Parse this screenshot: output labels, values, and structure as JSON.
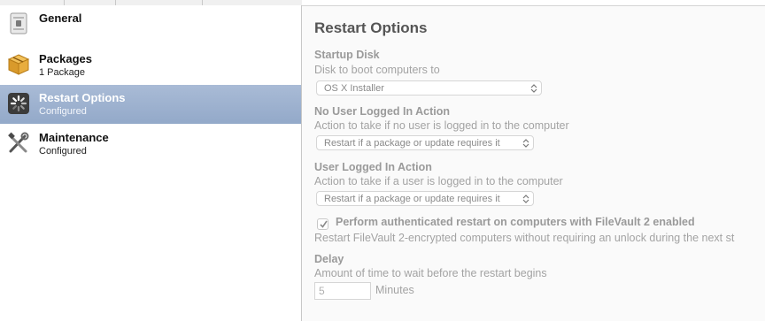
{
  "sidebar": {
    "items": [
      {
        "title": "General",
        "subtitle": "",
        "icon": "general-doc-icon"
      },
      {
        "title": "Packages",
        "subtitle": "1 Package",
        "icon": "package-box-icon"
      },
      {
        "title": "Restart Options",
        "subtitle": "Configured",
        "icon": "restart-spinner-icon",
        "selected": true
      },
      {
        "title": "Maintenance",
        "subtitle": "Configured",
        "icon": "tools-icon"
      }
    ]
  },
  "main": {
    "title": "Restart Options",
    "startup_disk": {
      "label": "Startup Disk",
      "description": "Disk to boot computers to",
      "value": "OS X Installer"
    },
    "no_user_action": {
      "label": "No User Logged In Action",
      "description": "Action to take if no user is logged in to the computer",
      "value": "Restart if a package or update requires it"
    },
    "user_action": {
      "label": "User Logged In Action",
      "description": "Action to take if a user is logged in to the computer",
      "value": "Restart if a package or update requires it"
    },
    "filevault": {
      "checked": true,
      "label": "Perform authenticated restart on computers with FileVault 2 enabled",
      "description": "Restart FileVault 2-encrypted computers without requiring an unlock during the next st"
    },
    "delay": {
      "label": "Delay",
      "description": "Amount of time to wait before the restart begins",
      "value": "5",
      "units": "Minutes"
    }
  },
  "colors": {
    "selection": "#9fb2cf",
    "label_gray": "#9a9a9a",
    "heading_gray": "#555555"
  }
}
